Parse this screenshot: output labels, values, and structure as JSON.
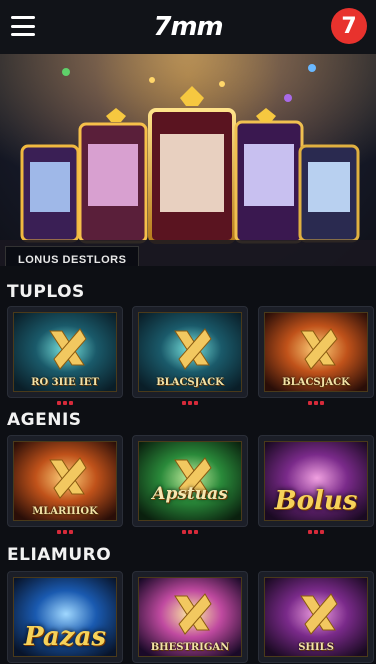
{
  "header": {
    "logo_text": "7mm",
    "badge_text": "7"
  },
  "hero": {
    "label": "LONUS DESTLORS"
  },
  "sections": [
    {
      "title": "TUPLOS",
      "cards": [
        {
          "caption": "RO 3IIE IET",
          "style": "small",
          "bg": "teal"
        },
        {
          "caption": "BLACSJACK",
          "style": "small",
          "bg": "teal"
        },
        {
          "caption": "BLACSJACK",
          "style": "small",
          "bg": "orange"
        }
      ]
    },
    {
      "title": "AGENIS",
      "cards": [
        {
          "caption": "MLARIIIOK",
          "style": "small",
          "bg": "orange"
        },
        {
          "caption": "Apstuas",
          "style": "mid",
          "bg": "green"
        },
        {
          "caption": "Bolus",
          "style": "big",
          "bg": "purple"
        }
      ]
    },
    {
      "title": "ELIAMURO",
      "cards": [
        {
          "caption": "Pazas",
          "style": "big",
          "bg": "blue"
        },
        {
          "caption": "BHESTRIGAN",
          "style": "small",
          "bg": "rainbow"
        },
        {
          "caption": "SHILS",
          "style": "small",
          "bg": "purple"
        }
      ]
    }
  ],
  "colors": {
    "accent": "#e8322d",
    "gold": "#f6d25a",
    "indicator": "#d62a3a"
  }
}
